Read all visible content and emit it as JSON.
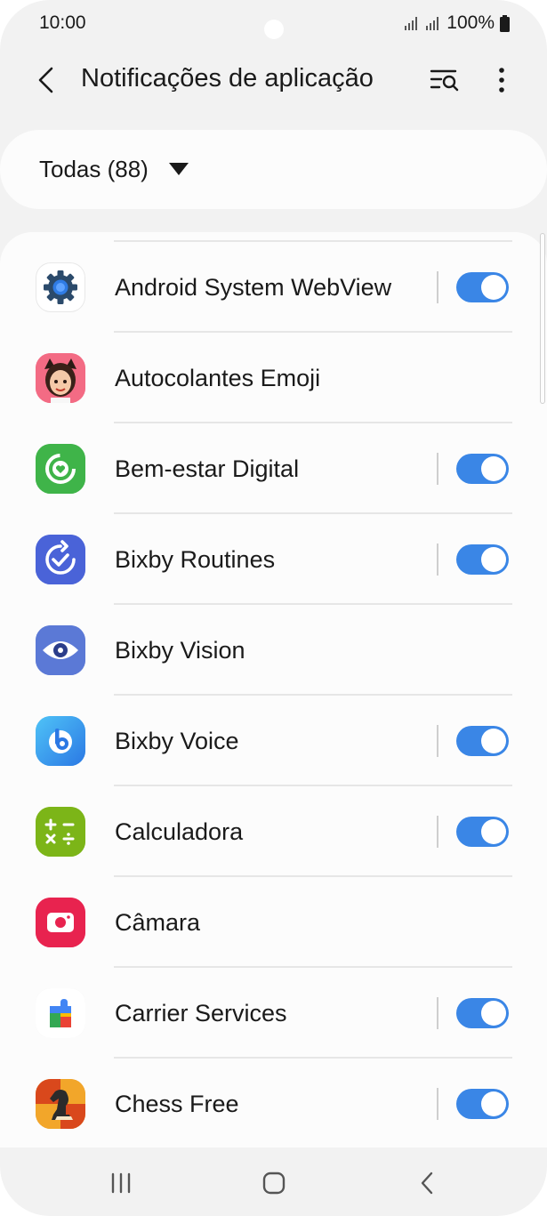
{
  "status_bar": {
    "time": "10:00",
    "battery": "100%"
  },
  "header": {
    "title": "Notificações de aplicação",
    "back_icon": "chevron-left-icon",
    "search_icon": "list-search-icon",
    "more_icon": "more-vertical-icon"
  },
  "filter": {
    "label": "Todas (88)",
    "arrow_icon": "caret-down-icon"
  },
  "apps": [
    {
      "name": "Android System WebView",
      "icon": "gear-icon",
      "toggle": true,
      "toggle_on": true
    },
    {
      "name": "Autocolantes Emoji",
      "icon": "avatar-emoji-icon",
      "toggle": false
    },
    {
      "name": "Bem-estar Digital",
      "icon": "wellbeing-icon",
      "toggle": true,
      "toggle_on": true
    },
    {
      "name": "Bixby Routines",
      "icon": "routines-check-icon",
      "toggle": true,
      "toggle_on": true
    },
    {
      "name": "Bixby Vision",
      "icon": "eye-icon",
      "toggle": false
    },
    {
      "name": "Bixby Voice",
      "icon": "bixby-b-icon",
      "toggle": true,
      "toggle_on": true
    },
    {
      "name": "Calculadora",
      "icon": "calculator-icon",
      "toggle": true,
      "toggle_on": true
    },
    {
      "name": "Câmara",
      "icon": "camera-icon",
      "toggle": false
    },
    {
      "name": "Carrier Services",
      "icon": "puzzle-icon",
      "toggle": true,
      "toggle_on": true
    },
    {
      "name": "Chess Free",
      "icon": "chess-knight-icon",
      "toggle": true,
      "toggle_on": true
    }
  ],
  "nav": {
    "recent_icon": "recent-apps-icon",
    "home_icon": "home-icon",
    "back_icon": "back-icon"
  },
  "colors": {
    "accent": "#3a86e6",
    "background": "#f2f2f2",
    "card": "#fcfcfc"
  }
}
